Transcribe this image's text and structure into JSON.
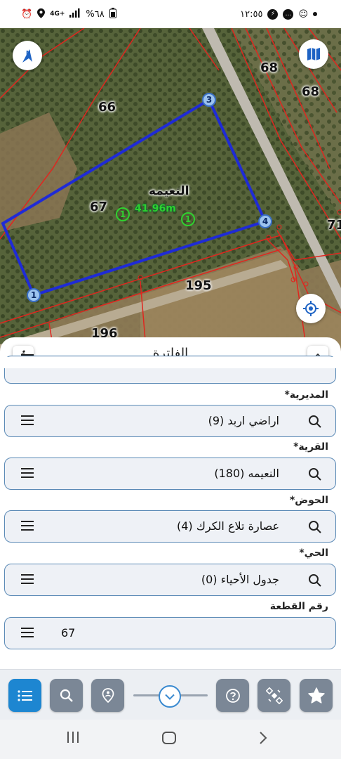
{
  "status_bar": {
    "battery": "%٦٨",
    "network": "4G+",
    "time": "١٢:٥٥"
  },
  "map": {
    "parcel_labels": [
      "66",
      "67",
      "68",
      "68",
      "195",
      "196",
      "71"
    ],
    "village_label": "النعيمه",
    "distance_label": "41.96m",
    "vertex_labels": [
      "1",
      "3",
      "4"
    ],
    "segment_marker": "1",
    "colors": {
      "parcel_outline": "#1f2bd6",
      "boundary_lines": "#e0261f",
      "measure": "#2fd12f"
    }
  },
  "sheet": {
    "title": "الفلترة",
    "info_label": "i",
    "fields": [
      {
        "label": "المديرية*",
        "value": "اراضي اربد (9)"
      },
      {
        "label": "القرية*",
        "value": "النعيمه (180)"
      },
      {
        "label": "الحوض*",
        "value": "عصارة تلاع الكرك (4)"
      },
      {
        "label": "الحي*",
        "value": "جدول الأحياء (0)"
      },
      {
        "label": "رقم القطعة",
        "value": "67"
      }
    ]
  },
  "toolbar": {
    "buttons": [
      "list-icon",
      "search-icon",
      "location-pin-icon",
      "help-icon",
      "satellite-icon",
      "star-icon"
    ],
    "active_color": "#1d86d1",
    "inactive_color": "#7b8796"
  }
}
